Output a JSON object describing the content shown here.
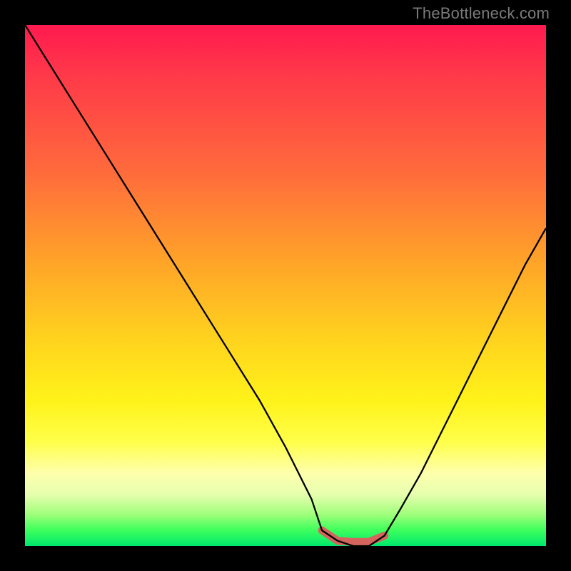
{
  "watermark": "TheBottleneck.com",
  "colors": {
    "background_top": "#ff1a4f",
    "background_mid1": "#ffa229",
    "background_mid2": "#fff21a",
    "background_bottom": "#00e86e",
    "curve_stroke": "#000000",
    "highlight_stroke": "#d4655e",
    "frame": "#000000",
    "watermark_text": "#7a7a7a"
  },
  "chart_data": {
    "type": "line",
    "title": "",
    "xlabel": "",
    "ylabel": "",
    "xlim": [
      0,
      100
    ],
    "ylim": [
      0,
      100
    ],
    "grid": false,
    "legend": false,
    "note": "V-shaped bottleneck curve on heatmap gradient; minimum band highlighted in red near bottom between x≈57 and x≈69; no axis ticks or numeric labels visible.",
    "series": [
      {
        "name": "bottleneck-curve",
        "x": [
          0,
          5,
          10,
          15,
          20,
          25,
          30,
          35,
          40,
          45,
          50,
          55,
          57,
          60,
          63,
          66,
          69,
          72,
          76,
          80,
          84,
          88,
          92,
          96,
          100
        ],
        "values": [
          100,
          92,
          84,
          76,
          68,
          60,
          52,
          44,
          36,
          28,
          19,
          9,
          3,
          1,
          0,
          0,
          2,
          7,
          14,
          22,
          30,
          38,
          46,
          54,
          61
        ]
      }
    ],
    "highlight_range": {
      "x_start": 57,
      "x_end": 69,
      "y": 1
    }
  }
}
